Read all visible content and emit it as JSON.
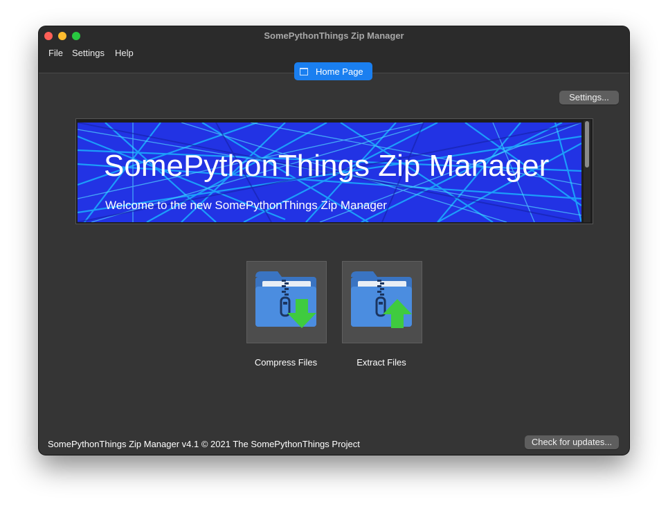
{
  "window": {
    "title": "SomePythonThings Zip Manager"
  },
  "menu": {
    "items": [
      "File",
      "Settings",
      "Help"
    ]
  },
  "tabs": [
    {
      "label": "Home Page",
      "icon": "window-icon",
      "active": true
    }
  ],
  "toolbar": {
    "settings_label": "Settings..."
  },
  "banner": {
    "title": "SomePythonThings Zip Manager",
    "subtitle": "Welcome to the new SomePythonThings Zip Manager"
  },
  "actions": [
    {
      "label": "Compress Files",
      "icon": "zip-folder-download-icon"
    },
    {
      "label": "Extract Files",
      "icon": "zip-folder-upload-icon"
    }
  ],
  "footer": {
    "text": "SomePythonThings Zip Manager v4.1  © 2021 The SomePythonThings Project",
    "update_label": "Check for updates..."
  },
  "colors": {
    "window_bg": "#353535",
    "titlebar_bg": "#2b2b2b",
    "accent": "#1a7ff0",
    "folder_blue": "#4b8de0",
    "arrow_green": "#3fcb3f",
    "banner_blue": "#2436e8"
  }
}
